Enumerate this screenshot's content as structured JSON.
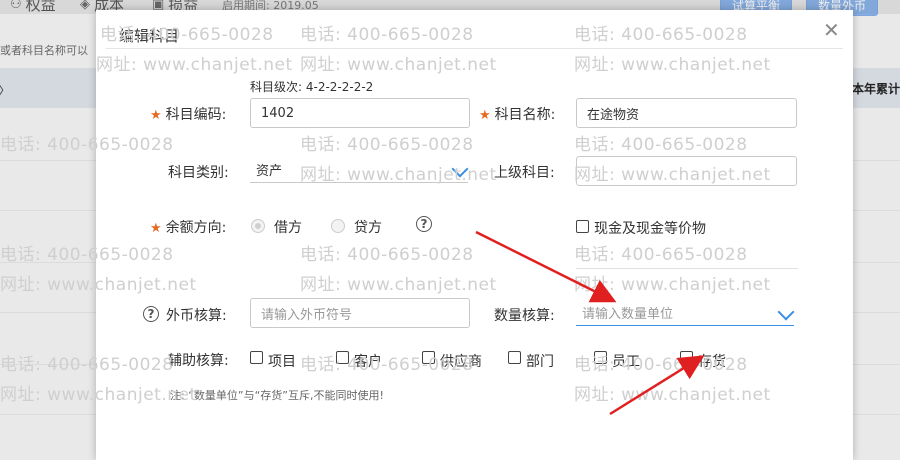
{
  "background": {
    "tabs": [
      "权益",
      "成本",
      "损益"
    ],
    "start_date": "启用期间: 2019.05",
    "buttons": [
      "试算平衡",
      "数量外币"
    ],
    "hint": "或者科目名称可以",
    "right_header": "本年累计借"
  },
  "dialog": {
    "title": "编辑科目",
    "level_text": "科目级次: 4-2-2-2-2-2",
    "code_label": "科目编码:",
    "code_value": "1402",
    "name_label": "科目名称:",
    "name_value": "在途物资",
    "category_label": "科目类别:",
    "category_value": "资产",
    "parent_label": "上级科目:",
    "parent_value": "",
    "balance_label": "余额方向:",
    "debit_label": "借方",
    "credit_label": "贷方",
    "cash_equiv_label": "现金及现金等价物",
    "foreign_label": "外币核算:",
    "foreign_placeholder": "请输入外币符号",
    "quantity_label": "数量核算:",
    "quantity_placeholder": "请输入数量单位",
    "aux_label": "辅助核算:",
    "aux_options": [
      "项目",
      "客户",
      "供应商",
      "部门",
      "员工",
      "存货"
    ],
    "note": "注: “数量单位”与“存货”互斥,不能同时使用!"
  },
  "watermark": {
    "phone": "电话: 400-665-0028",
    "site": "网址: www.chanjet.net"
  },
  "colors": {
    "accent": "#3a8ee6",
    "required_star": "#e56a24",
    "arrow": "#e02020"
  }
}
